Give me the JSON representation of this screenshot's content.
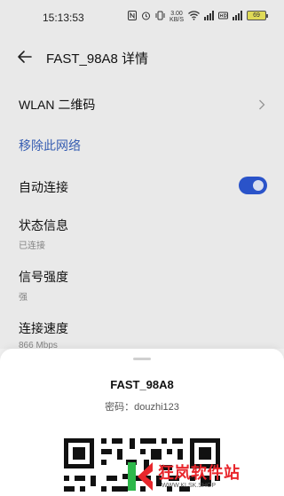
{
  "status_bar": {
    "time": "15:13:53",
    "net_speed_value": "3.00",
    "net_speed_unit": "KB/S",
    "battery_level": "69",
    "icons": [
      "nfc-icon",
      "alarm-icon",
      "vibrate-icon",
      "net-speed",
      "wifi-icon",
      "signal-icon",
      "hd-icon",
      "signal-icon",
      "battery-icon"
    ]
  },
  "header": {
    "title": "FAST_98A8 详情"
  },
  "settings": {
    "qr_label": "WLAN 二维码",
    "remove_label": "移除此网络",
    "auto_connect_label": "自动连接",
    "auto_connect_on": true,
    "status_label": "状态信息",
    "status_value": "已连接",
    "signal_label": "信号强度",
    "signal_value": "强",
    "speed_label": "连接速度",
    "speed_value": "866 Mbps"
  },
  "sheet": {
    "ssid": "FAST_98A8",
    "password_line": "密码：douzhi123"
  },
  "watermark": {
    "text": "狂岚软件站",
    "url": "WWW.KLSK.SHOP"
  },
  "colors": {
    "accent": "#2c56d0",
    "link": "#3a62b8",
    "background": "#f1f1f1",
    "watermark_red": "#e8262c",
    "watermark_green": "#2eb84a"
  }
}
